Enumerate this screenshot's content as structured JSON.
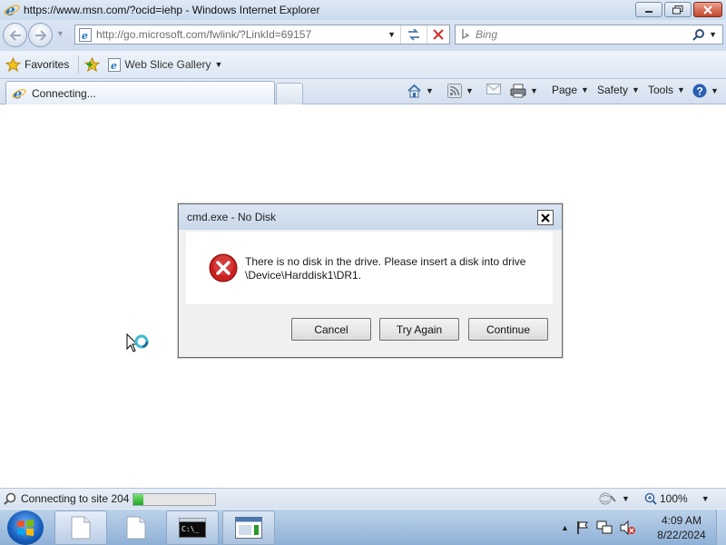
{
  "window": {
    "title": "https://www.msn.com/?ocid=iehp - Windows Internet Explorer"
  },
  "address_bar": {
    "url": "http://go.microsoft.com/fwlink/?LinkId=69157",
    "search_placeholder": "Bing"
  },
  "favorites_bar": {
    "favorites_label": "Favorites",
    "web_slice_label": "Web Slice Gallery"
  },
  "tabs": [
    {
      "label": "Connecting..."
    }
  ],
  "command_bar": {
    "page_label": "Page",
    "safety_label": "Safety",
    "tools_label": "Tools"
  },
  "dialog": {
    "title": "cmd.exe - No Disk",
    "message_line1": "There is no disk in the drive. Please insert a disk into drive",
    "message_line2": "\\Device\\Harddisk1\\DR1.",
    "buttons": {
      "cancel": "Cancel",
      "try_again": "Try Again",
      "continue": "Continue"
    }
  },
  "status_bar": {
    "status_text": "Connecting to site 204",
    "progress": 0.12,
    "zoom": "100%"
  },
  "taskbar": {
    "time": "4:09 AM",
    "date": "8/22/2024"
  },
  "colors": {
    "error_red": "#c8201f",
    "progress_green": "#20a820",
    "taskbar_blue": "#8fb0d6"
  }
}
